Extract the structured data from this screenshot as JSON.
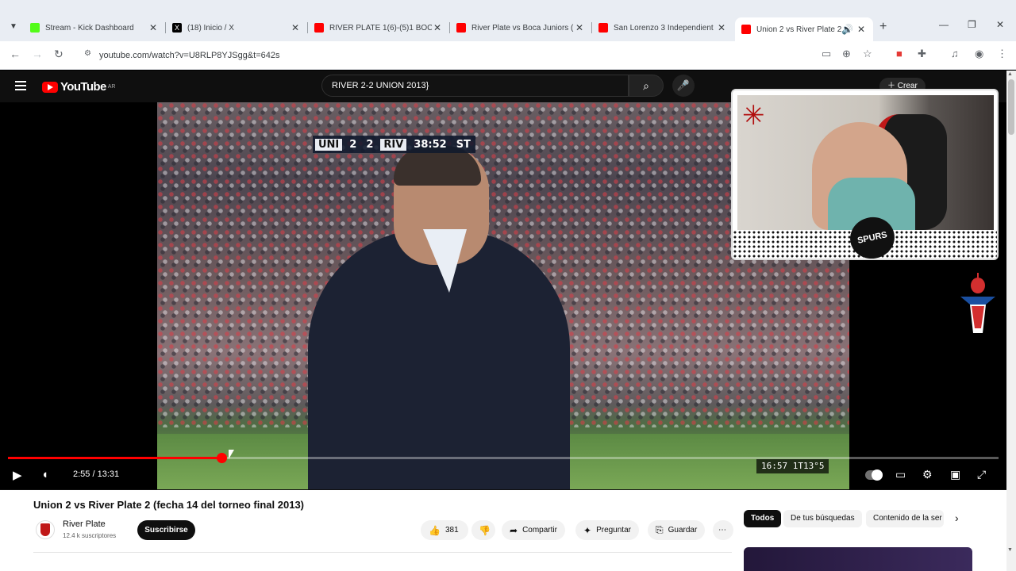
{
  "browser": {
    "tabs": [
      {
        "title": "Stream - Kick Dashboard",
        "favicon": "kick-icon",
        "color": "#53fc18"
      },
      {
        "title": "(18) Inicio / X",
        "favicon": "x-icon",
        "color": "#000000"
      },
      {
        "title": "RIVER PLATE 1(6)-(5)1 BOCA",
        "favicon": "youtube-icon",
        "color": "#ff0000"
      },
      {
        "title": "River Plate vs Boca Juniors (",
        "favicon": "youtube-icon",
        "color": "#ff0000"
      },
      {
        "title": "San Lorenzo 3 Independient",
        "favicon": "youtube-icon",
        "color": "#ff0000"
      },
      {
        "title": "Union 2 vs River Plate 2 (",
        "favicon": "youtube-icon",
        "color": "#ff0000",
        "active": true
      }
    ],
    "url": "youtube.com/watch?v=U8RLP8YJSgg&t=642s"
  },
  "youtube": {
    "logo_text": "YouTube",
    "region": "AR",
    "search_query": "RIVER 2-2 UNION 2013}",
    "create_label": "Crear"
  },
  "player": {
    "scorebug": {
      "home": "UNI",
      "home_score": "2",
      "away_score": "2",
      "away": "RIV",
      "clock": "38:52",
      "half": "ST"
    },
    "broadcast_timestamp": "16:57 1T13°5",
    "time_display": "2:55 / 13:31",
    "progress_fraction": 0.2158,
    "accent_color": "#ff0000",
    "webcam_logo_text": "SPURS KP"
  },
  "video": {
    "title": "Union 2 vs River Plate 2 (fecha 14 del torneo final 2013)",
    "channel": "River Plate",
    "subscribers": "12.4 k suscriptores",
    "subscribe_label": "Suscribirse",
    "likes": "381",
    "share_label": "Compartir",
    "ask_label": "Preguntar",
    "save_label": "Guardar"
  },
  "chips": [
    "Todos",
    "De tus búsquedas",
    "Contenido de la ser"
  ]
}
